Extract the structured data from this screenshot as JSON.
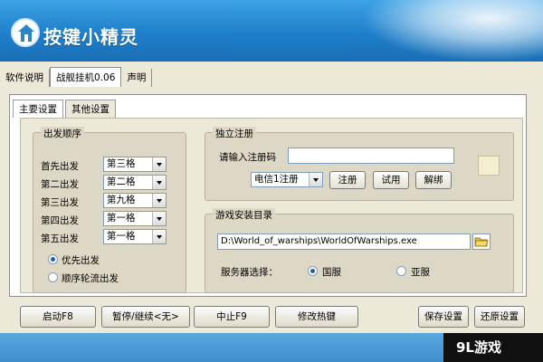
{
  "app": {
    "title": "按键小精灵"
  },
  "top_tabs": [
    "软件说明",
    "战舰挂机0.06",
    "声明"
  ],
  "inner_tabs": [
    "主要设置",
    "其他设置"
  ],
  "departure": {
    "title": "出发顺序",
    "rows": [
      {
        "label": "首先出发",
        "value": "第三格"
      },
      {
        "label": "第二出发",
        "value": "第二格"
      },
      {
        "label": "第三出发",
        "value": "第九格"
      },
      {
        "label": "第四出发",
        "value": "第一格"
      },
      {
        "label": "第五出发",
        "value": "第一格"
      }
    ],
    "options": [
      {
        "label": "优先出发",
        "selected": true
      },
      {
        "label": "顺序轮流出发",
        "selected": false
      }
    ]
  },
  "registration": {
    "title": "独立注册",
    "code_label": "请输入注册码",
    "code_value": "",
    "line_select": "电信1注册",
    "register": "注册",
    "trial": "试用",
    "unbind": "解绑"
  },
  "install": {
    "title": "游戏安装目录",
    "path": "D:\\World_of_warships\\WorldOfWarships.exe",
    "server_label": "服务器选择：",
    "servers": [
      {
        "label": "国服",
        "selected": true
      },
      {
        "label": "亚服",
        "selected": false
      }
    ]
  },
  "bottom": {
    "start": "启动F8",
    "pause": "暂停/继续<无>",
    "stop": "中止F9",
    "hotkey": "修改热键",
    "save": "保存设置",
    "restore": "还原设置"
  },
  "watermark": "9L游戏",
  "colors": {
    "title_bar": "#1f7fca",
    "window_bg": "#ece9d8",
    "group_bg": "#ddd8c6"
  }
}
